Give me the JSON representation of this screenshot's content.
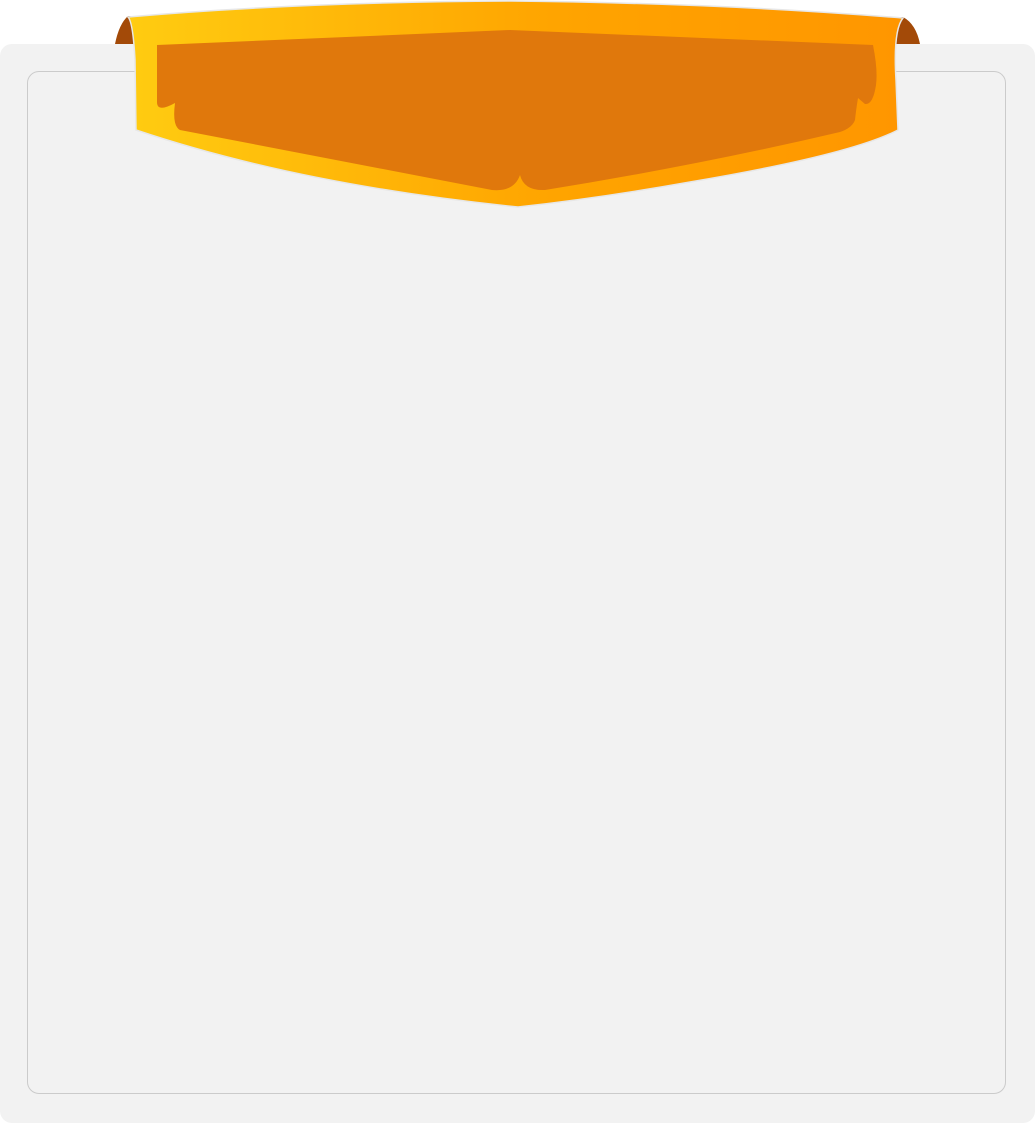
{
  "window": {
    "title": ""
  },
  "colors": {
    "panel_background": "#f2f2f2",
    "panel_inner_border": "#cbcbcb",
    "banner_gradient_start": "#ffcc11",
    "banner_gradient_end": "#ff9600",
    "banner_inner_fill": "#e0780c",
    "banner_fold": "#a34a08"
  },
  "icons": {
    "banner": "ribbon-banner-icon",
    "banner_fold_left": "ribbon-fold-left-icon",
    "banner_fold_right": "ribbon-fold-right-icon"
  }
}
